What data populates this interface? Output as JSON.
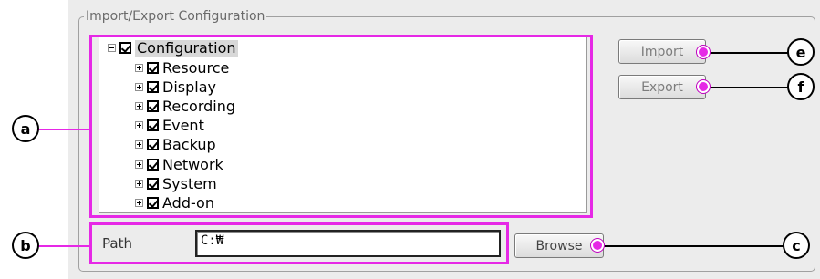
{
  "group": {
    "title": "Import/Export Configuration"
  },
  "tree": {
    "root": {
      "label": "Configuration",
      "checked": true
    },
    "items": [
      {
        "label": "Resource",
        "checked": true
      },
      {
        "label": "Display",
        "checked": true
      },
      {
        "label": "Recording",
        "checked": true
      },
      {
        "label": "Event",
        "checked": true
      },
      {
        "label": "Backup",
        "checked": true
      },
      {
        "label": "Network",
        "checked": true
      },
      {
        "label": "System",
        "checked": true
      },
      {
        "label": "Add-on",
        "checked": true
      }
    ]
  },
  "buttons": {
    "import": "Import",
    "export": "Export",
    "browse": "Browse"
  },
  "path": {
    "label": "Path",
    "value": "C:₩"
  },
  "callouts": {
    "a": "a",
    "b": "b",
    "c": "c",
    "e": "e",
    "f": "f"
  },
  "colors": {
    "highlight": "#e628e6",
    "panel": "#ececec"
  }
}
